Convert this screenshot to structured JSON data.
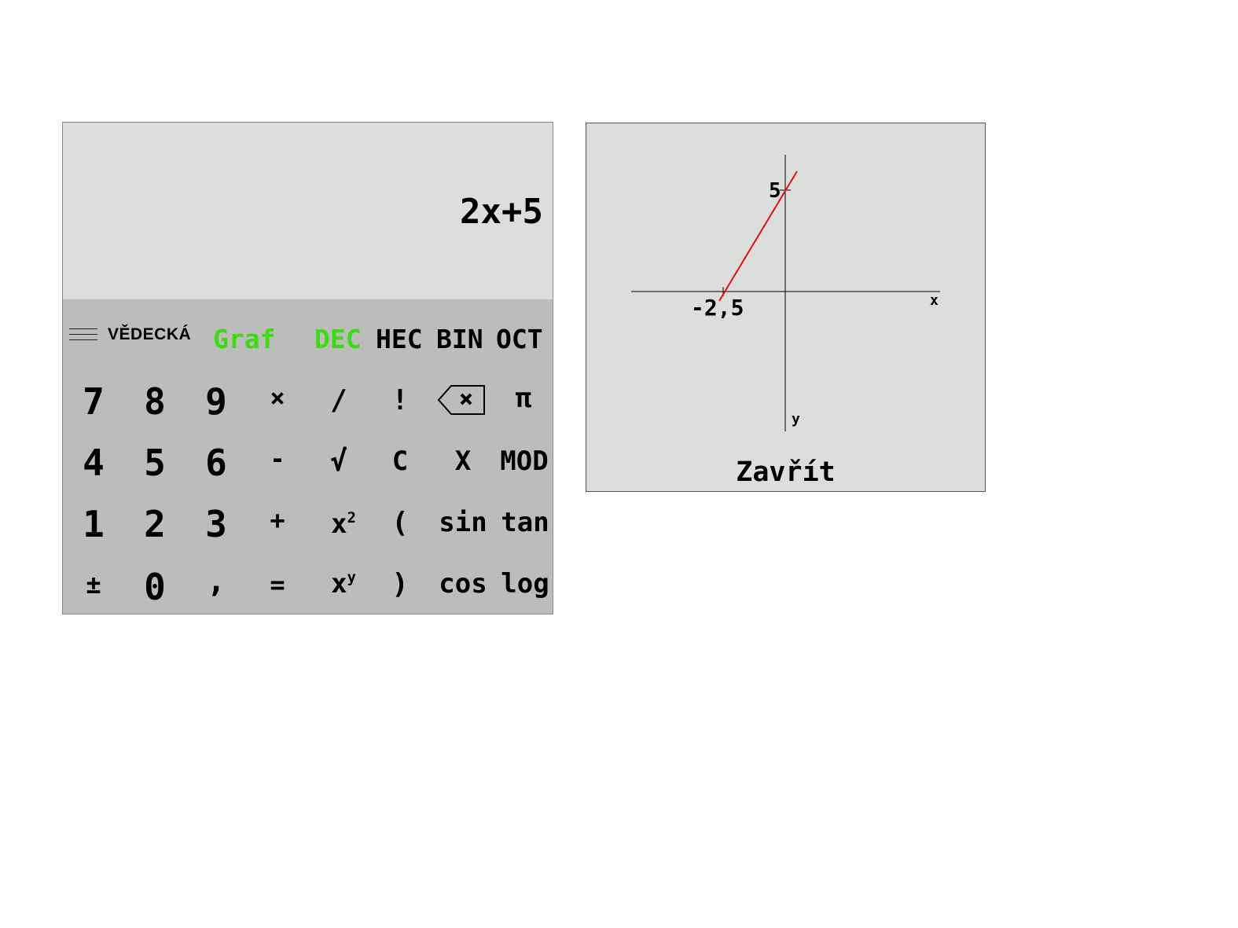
{
  "display": {
    "expression": "2x+5"
  },
  "menu": {
    "icon": "hamburger-icon",
    "mode_label": "VĚDECKÁ"
  },
  "tabs": {
    "graf": "Graf",
    "dec": "DEC",
    "hec": "HEC",
    "bin": "BIN",
    "oct": "OCT",
    "active_color": "#3cdc14"
  },
  "keys": {
    "row1": [
      "7",
      "8",
      "9",
      "×",
      "/",
      "!",
      "backspace-icon",
      "π"
    ],
    "row2": [
      "4",
      "5",
      "6",
      "-",
      "√",
      "C",
      "X",
      "MOD"
    ],
    "row3": [
      "1",
      "2",
      "3",
      "+",
      "x2",
      "(",
      "sin",
      "tan"
    ],
    "row4": [
      "±",
      "0",
      ",",
      "=",
      "xy",
      ")",
      "cos",
      "log"
    ],
    "sup_x2": {
      "base": "x",
      "sup": "2"
    },
    "sup_xy": {
      "base": "x",
      "sup": "y"
    }
  },
  "graph": {
    "function": "2x+5",
    "y_intercept_label": "5",
    "x_intercept_label": "-2,5",
    "x_axis_label": "x",
    "y_axis_label": "y",
    "line_color": "#e01010",
    "close_label": "Zavřít"
  }
}
